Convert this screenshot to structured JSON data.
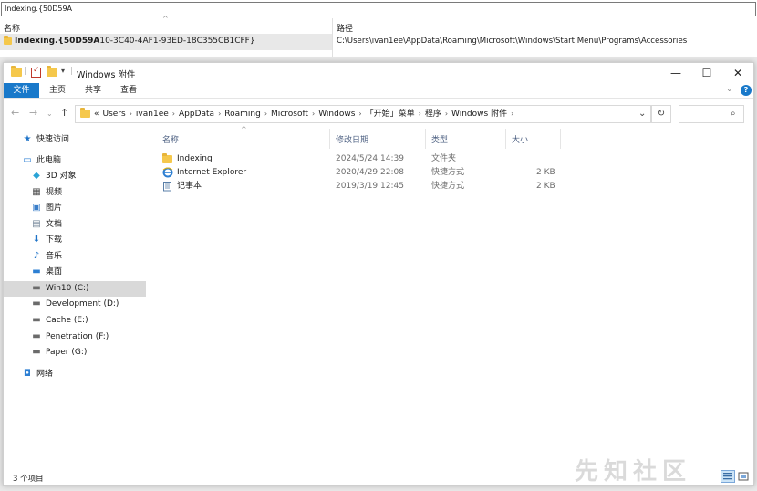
{
  "bg_search": {
    "query": "Indexing.{50D59A",
    "col_name": "名称",
    "col_path": "路径",
    "row_name_bold": "Indexing.{50D59A",
    "row_name_rest": "10-3C40-4AF1-93ED-18C355CB1CFF}",
    "row_path": "C:\\Users\\ivan1ee\\AppData\\Roaming\\Microsoft\\Windows\\Start Menu\\Programs\\Accessories"
  },
  "window": {
    "title": "Windows 附件",
    "minimize": "—",
    "maximize": "☐",
    "close": "✕"
  },
  "ribbon": {
    "tabs": [
      "文件",
      "主页",
      "共享",
      "查看"
    ]
  },
  "address": {
    "overflow": "«",
    "crumbs": [
      "Users",
      "ivan1ee",
      "AppData",
      "Roaming",
      "Microsoft",
      "Windows",
      "「开始」菜单",
      "程序",
      "Windows 附件"
    ]
  },
  "nav_pane": {
    "items": [
      {
        "label": "快速访问",
        "icon": "star-icon"
      },
      {
        "label": "此电脑",
        "icon": "computer-icon"
      },
      {
        "label": "3D 对象",
        "icon": "cube-icon"
      },
      {
        "label": "视频",
        "icon": "video-icon"
      },
      {
        "label": "图片",
        "icon": "picture-icon"
      },
      {
        "label": "文档",
        "icon": "document-icon"
      },
      {
        "label": "下载",
        "icon": "download-icon"
      },
      {
        "label": "音乐",
        "icon": "music-icon"
      },
      {
        "label": "桌面",
        "icon": "desktop-icon"
      },
      {
        "label": "Win10 (C:)",
        "icon": "drive-icon"
      },
      {
        "label": "Development (D:)",
        "icon": "drive-icon"
      },
      {
        "label": "Cache (E:)",
        "icon": "drive-icon"
      },
      {
        "label": "Penetration (F:)",
        "icon": "drive-icon"
      },
      {
        "label": "Paper (G:)",
        "icon": "drive-icon"
      },
      {
        "label": "网络",
        "icon": "network-icon"
      }
    ]
  },
  "file_list": {
    "columns": [
      "名称",
      "修改日期",
      "类型",
      "大小"
    ],
    "rows": [
      {
        "name": "Indexing",
        "date": "2024/5/24 14:39",
        "type": "文件夹",
        "size": "",
        "icon": "folder-icon"
      },
      {
        "name": "Internet Explorer",
        "date": "2020/4/29 22:08",
        "type": "快捷方式",
        "size": "2 KB",
        "icon": "ie-icon"
      },
      {
        "name": "记事本",
        "date": "2019/3/19 12:45",
        "type": "快捷方式",
        "size": "2 KB",
        "icon": "notepad-icon"
      }
    ]
  },
  "status": {
    "count": "3 个项目"
  },
  "watermark": "先知社区",
  "colors": {
    "accent": "#1979ca",
    "folder": "#f5c84c",
    "selection": "#d9d9d9",
    "header_text": "#4d6082"
  }
}
